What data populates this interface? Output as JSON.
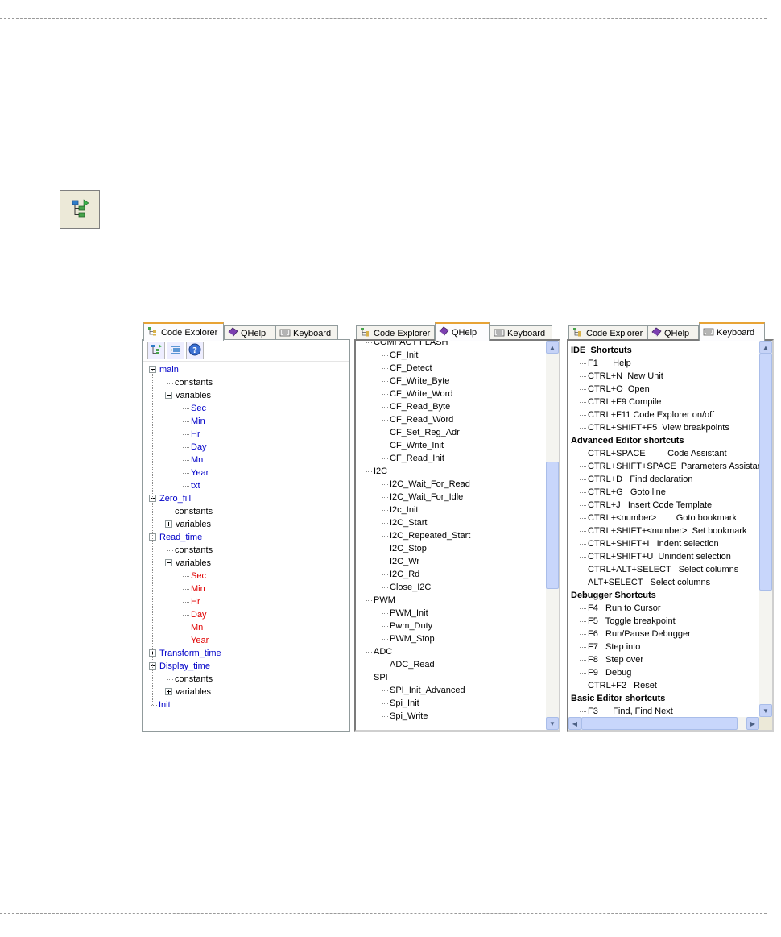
{
  "toolbar_big_icon": "code-explorer-new-icon",
  "code_explorer_panel": {
    "tabs": [
      {
        "label": "Code Explorer",
        "icon": "code-explorer-icon",
        "active": true
      },
      {
        "label": "QHelp",
        "icon": "book-icon",
        "active": false
      },
      {
        "label": "Keyboard",
        "icon": "keyboard-icon",
        "active": false
      }
    ],
    "toolbar_icons": [
      "tree-expand-icon",
      "collapse-icon",
      "help-icon"
    ],
    "tree": [
      {
        "label": "main",
        "level": 0,
        "expander": "minus",
        "color": "blue"
      },
      {
        "label": "constants",
        "level": 1,
        "expander": "none",
        "color": "black"
      },
      {
        "label": "variables",
        "level": 1,
        "expander": "minus",
        "color": "black"
      },
      {
        "label": "Sec",
        "level": 2,
        "expander": "none",
        "color": "blue"
      },
      {
        "label": "Min",
        "level": 2,
        "expander": "none",
        "color": "blue"
      },
      {
        "label": "Hr",
        "level": 2,
        "expander": "none",
        "color": "blue"
      },
      {
        "label": "Day",
        "level": 2,
        "expander": "none",
        "color": "blue"
      },
      {
        "label": "Mn",
        "level": 2,
        "expander": "none",
        "color": "blue"
      },
      {
        "label": "Year",
        "level": 2,
        "expander": "none",
        "color": "blue"
      },
      {
        "label": "txt",
        "level": 2,
        "expander": "none",
        "color": "blue"
      },
      {
        "label": "Zero_fill",
        "level": 0,
        "expander": "minus",
        "color": "blue"
      },
      {
        "label": "constants",
        "level": 1,
        "expander": "none",
        "color": "black"
      },
      {
        "label": "variables",
        "level": 1,
        "expander": "plus",
        "color": "black"
      },
      {
        "label": "Read_time",
        "level": 0,
        "expander": "minus",
        "color": "blue"
      },
      {
        "label": "constants",
        "level": 1,
        "expander": "none",
        "color": "black"
      },
      {
        "label": "variables",
        "level": 1,
        "expander": "minus",
        "color": "black"
      },
      {
        "label": "Sec",
        "level": 2,
        "expander": "none",
        "color": "red"
      },
      {
        "label": "Min",
        "level": 2,
        "expander": "none",
        "color": "red"
      },
      {
        "label": "Hr",
        "level": 2,
        "expander": "none",
        "color": "red"
      },
      {
        "label": "Day",
        "level": 2,
        "expander": "none",
        "color": "red"
      },
      {
        "label": "Mn",
        "level": 2,
        "expander": "none",
        "color": "red"
      },
      {
        "label": "Year",
        "level": 2,
        "expander": "none",
        "color": "red"
      },
      {
        "label": "Transform_time",
        "level": 0,
        "expander": "plus",
        "color": "blue"
      },
      {
        "label": "Display_time",
        "level": 0,
        "expander": "minus",
        "color": "blue"
      },
      {
        "label": "constants",
        "level": 1,
        "expander": "none",
        "color": "black"
      },
      {
        "label": "variables",
        "level": 1,
        "expander": "plus",
        "color": "black"
      },
      {
        "label": "Init",
        "level": 0,
        "expander": "none",
        "color": "blue"
      }
    ]
  },
  "qhelp_panel": {
    "tabs": [
      {
        "label": "Code Explorer",
        "icon": "code-explorer-icon",
        "active": false
      },
      {
        "label": "QHelp",
        "icon": "book-icon",
        "active": true
      },
      {
        "label": "Keyboard",
        "icon": "keyboard-icon",
        "active": false
      }
    ],
    "items": [
      {
        "label": "COMPACT FLASH",
        "level": 0
      },
      {
        "label": "CF_Init",
        "level": 1
      },
      {
        "label": "CF_Detect",
        "level": 1
      },
      {
        "label": "CF_Write_Byte",
        "level": 1
      },
      {
        "label": "CF_Write_Word",
        "level": 1
      },
      {
        "label": "CF_Read_Byte",
        "level": 1
      },
      {
        "label": "CF_Read_Word",
        "level": 1
      },
      {
        "label": "CF_Set_Reg_Adr",
        "level": 1
      },
      {
        "label": "CF_Write_Init",
        "level": 1
      },
      {
        "label": "CF_Read_Init",
        "level": 1
      },
      {
        "label": "I2C",
        "level": 0
      },
      {
        "label": "I2C_Wait_For_Read",
        "level": 1
      },
      {
        "label": "I2C_Wait_For_Idle",
        "level": 1
      },
      {
        "label": "I2c_Init",
        "level": 1
      },
      {
        "label": "I2C_Start",
        "level": 1
      },
      {
        "label": "I2C_Repeated_Start",
        "level": 1
      },
      {
        "label": "I2C_Stop",
        "level": 1
      },
      {
        "label": "I2C_Wr",
        "level": 1
      },
      {
        "label": "I2C_Rd",
        "level": 1
      },
      {
        "label": "Close_I2C",
        "level": 1
      },
      {
        "label": "PWM",
        "level": 0
      },
      {
        "label": "PWM_Init",
        "level": 1
      },
      {
        "label": "Pwm_Duty",
        "level": 1
      },
      {
        "label": "PWM_Stop",
        "level": 1
      },
      {
        "label": "ADC",
        "level": 0
      },
      {
        "label": "ADC_Read",
        "level": 1
      },
      {
        "label": "SPI",
        "level": 0
      },
      {
        "label": "SPI_Init_Advanced",
        "level": 1
      },
      {
        "label": "Spi_Init",
        "level": 1
      },
      {
        "label": "Spi_Write",
        "level": 1
      }
    ],
    "scroll_position": 0.35
  },
  "keyboard_panel": {
    "tabs": [
      {
        "label": "Code Explorer",
        "icon": "code-explorer-icon",
        "active": false
      },
      {
        "label": "QHelp",
        "icon": "book-icon",
        "active": false
      },
      {
        "label": "Keyboard",
        "icon": "keyboard-icon",
        "active": true
      }
    ],
    "items": [
      {
        "label": "IDE  Shortcuts",
        "heading": true
      },
      {
        "label": "F1      Help",
        "heading": false
      },
      {
        "label": "CTRL+N  New Unit",
        "heading": false
      },
      {
        "label": "CTRL+O  Open",
        "heading": false
      },
      {
        "label": "CTRL+F9 Compile",
        "heading": false
      },
      {
        "label": "CTRL+F11 Code Explorer on/off",
        "heading": false
      },
      {
        "label": "CTRL+SHIFT+F5  View breakpoints",
        "heading": false
      },
      {
        "label": "Advanced Editor shortcuts",
        "heading": true
      },
      {
        "label": "CTRL+SPACE         Code Assistant",
        "heading": false
      },
      {
        "label": "CTRL+SHIFT+SPACE  Parameters Assistar",
        "heading": false
      },
      {
        "label": "CTRL+D   Find declaration",
        "heading": false
      },
      {
        "label": "CTRL+G   Goto line",
        "heading": false
      },
      {
        "label": "CTRL+J   Insert Code Template",
        "heading": false
      },
      {
        "label": "CTRL+<number>        Goto bookmark",
        "heading": false
      },
      {
        "label": "CTRL+SHIFT+<number>  Set bookmark",
        "heading": false
      },
      {
        "label": "CTRL+SHIFT+I   Indent selection",
        "heading": false
      },
      {
        "label": "CTRL+SHIFT+U  Unindent selection",
        "heading": false
      },
      {
        "label": "CTRL+ALT+SELECT   Select columns",
        "heading": false
      },
      {
        "label": "ALT+SELECT   Select columns",
        "heading": false
      },
      {
        "label": "Debugger Shortcuts",
        "heading": true
      },
      {
        "label": "F4   Run to Cursor",
        "heading": false
      },
      {
        "label": "F5   Toggle breakpoint",
        "heading": false
      },
      {
        "label": "F6   Run/Pause Debugger",
        "heading": false
      },
      {
        "label": "F7   Step into",
        "heading": false
      },
      {
        "label": "F8   Step over",
        "heading": false
      },
      {
        "label": "F9   Debug",
        "heading": false
      },
      {
        "label": "CTRL+F2   Reset",
        "heading": false
      },
      {
        "label": "Basic Editor shortcuts",
        "heading": true
      },
      {
        "label": "F3      Find, Find Next",
        "heading": false
      }
    ],
    "scroll_position": 0.0
  }
}
